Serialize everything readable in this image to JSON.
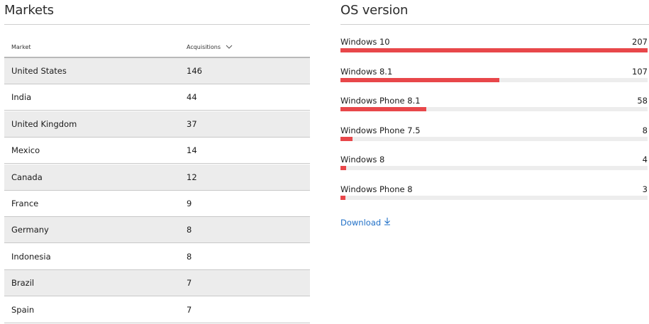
{
  "markets": {
    "title": "Markets",
    "columns": {
      "market": "Market",
      "acquisitions": "Acquisitions"
    },
    "sort_icon": "chevron-down-icon",
    "rows": [
      {
        "market": "United States",
        "value": "146"
      },
      {
        "market": "India",
        "value": "44"
      },
      {
        "market": "United Kingdom",
        "value": "37"
      },
      {
        "market": "Mexico",
        "value": "14"
      },
      {
        "market": "Canada",
        "value": "12"
      },
      {
        "market": "France",
        "value": "9"
      },
      {
        "market": "Germany",
        "value": "8"
      },
      {
        "market": "Indonesia",
        "value": "8"
      },
      {
        "market": "Brazil",
        "value": "7"
      },
      {
        "market": "Spain",
        "value": "7"
      }
    ]
  },
  "os_version": {
    "title": "OS version",
    "bar_color": "#e8474a",
    "max_value": 207,
    "items": [
      {
        "name": "Windows 10",
        "value": 207
      },
      {
        "name": "Windows 8.1",
        "value": 107
      },
      {
        "name": "Windows Phone 8.1",
        "value": 58
      },
      {
        "name": "Windows Phone 7.5",
        "value": 8
      },
      {
        "name": "Windows 8",
        "value": 4
      },
      {
        "name": "Windows Phone 8",
        "value": 3
      }
    ],
    "download_label": "Download",
    "download_icon": "download-arrow-icon"
  }
}
